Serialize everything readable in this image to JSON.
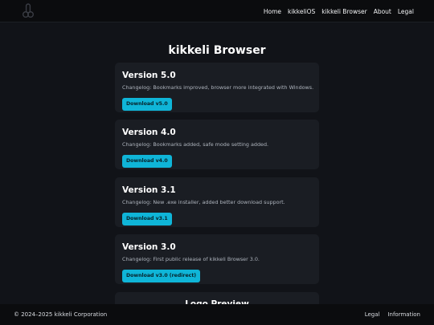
{
  "nav": {
    "logo_icon": "logo-icon",
    "links": [
      "Home",
      "kikkeliOS",
      "kikkeli Browser",
      "About",
      "Legal"
    ]
  },
  "page": {
    "title": "kikkeli Browser"
  },
  "versions": [
    {
      "title": "Version 5.0",
      "changelog": "Changelog: Bookmarks improved, browser more integrated with Windows.",
      "button": "Download v5.0"
    },
    {
      "title": "Version 4.0",
      "changelog": "Changelog: Bookmarks added, safe mode setting added.",
      "button": "Download v4.0"
    },
    {
      "title": "Version 3.1",
      "changelog": "Changelog: New .exe installer, added better download support.",
      "button": "Download v3.1"
    },
    {
      "title": "Version 3.0",
      "changelog": "Changelog: First public release of kikkeli Browser 3.0.",
      "button": "Download v3.0 (redirect)"
    }
  ],
  "preview": {
    "title": "Logo Preview"
  },
  "footer": {
    "copyright": "© 2024–2025 kikkeli Corporation",
    "links": [
      "Legal",
      "Information"
    ]
  },
  "colors": {
    "accent": "#0fb5d8",
    "background": "#111318",
    "card": "#1a1d23"
  }
}
